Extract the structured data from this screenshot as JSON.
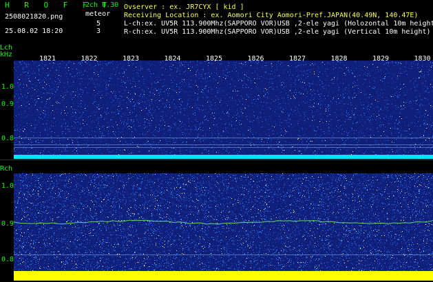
{
  "header": {
    "app_title": "H R O F F T",
    "channel_mode": "2ch 0.30",
    "file_name": "2508021820.png",
    "date_time": "25.08.02 18:20",
    "meteor_label": "meteor",
    "meteor_l_count": "5",
    "meteor_r_count": "3"
  },
  "info": {
    "observer": "Ovserver            : ex. JR7CYX [ kid ]",
    "location": "Receiving Location : ex. Aomori City Aomori-Pref.JAPAN(40.49N, 140.47E)",
    "lch": "L-ch:ex. UV5R 113.900Mhz(SAPPORO VOR)USB ,2-ele yagi (Holozontal 10m height)",
    "rch": "R-ch:ex. UV5R 113.900Mhz(SAPPORO VOR)USB ,2-ele yagi (Vertical 10m height)"
  },
  "lch_panel": {
    "label": "Lch",
    "unit": "kHz",
    "yticks": [
      "1.0",
      "0.9",
      "0.8"
    ]
  },
  "rch_panel": {
    "label": "Rch",
    "yticks": [
      "1.0",
      "0.9",
      "0.8"
    ]
  },
  "hour_labels": [
    "1821",
    "1822",
    "1823",
    "1824",
    "1825",
    "1826",
    "1827",
    "1828",
    "1829",
    "1830"
  ],
  "colors": {
    "spectrum_bg": "#10207a",
    "noise": "#3a8cff",
    "lch_band": "#00e5ff",
    "rch_band": "#ffff00",
    "signal_trace": "#7cff60",
    "title_green": "#00ff00"
  }
}
